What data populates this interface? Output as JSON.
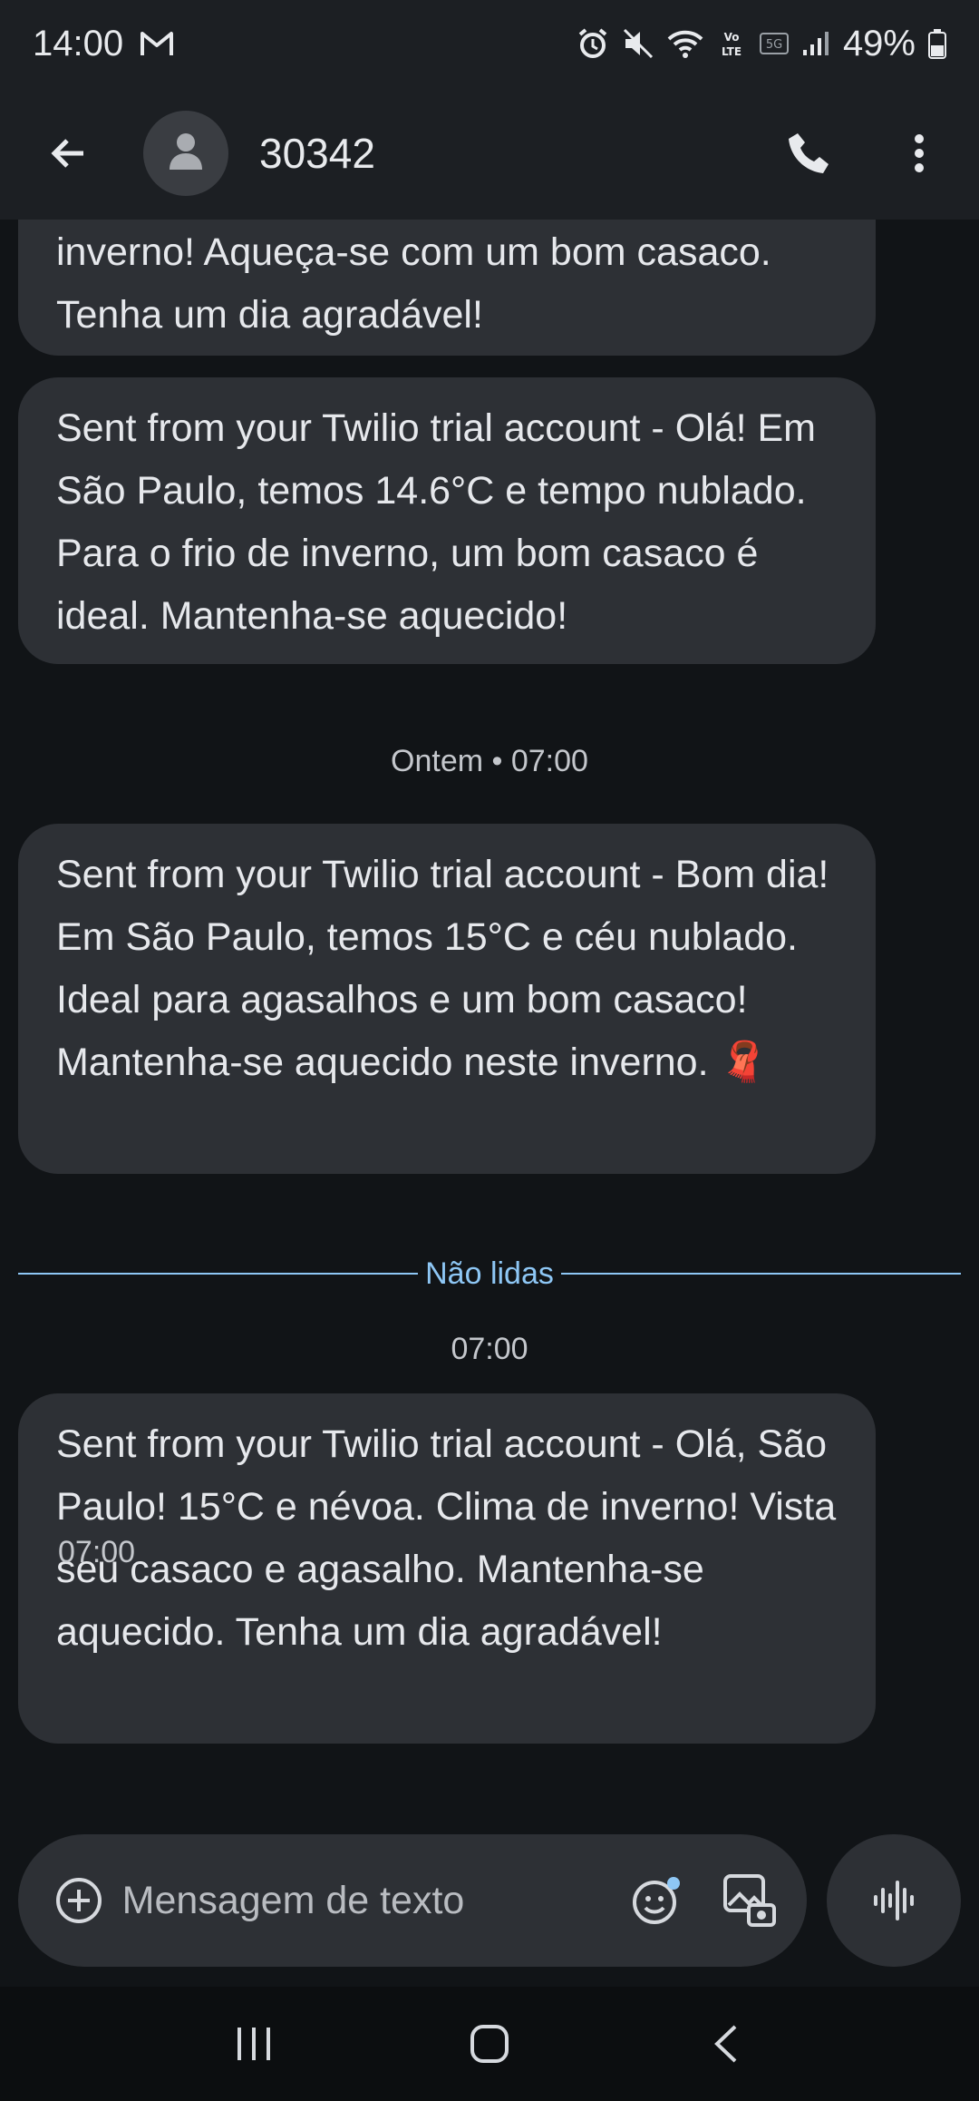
{
  "status_bar": {
    "time": "14:00",
    "battery": "49%",
    "icons": [
      "gmail-icon",
      "alarm-icon",
      "mute-icon",
      "wifi-icon",
      "volte-icon",
      "5g-icon",
      "signal-icon",
      "battery-icon"
    ]
  },
  "header": {
    "contact": "30342",
    "icons": [
      "back-arrow-icon",
      "person-avatar-icon",
      "phone-icon",
      "more-vert-icon"
    ]
  },
  "messages": [
    {
      "text": "inverno! Aqueça-se com um bom casaco. Tenha um dia agradável!"
    },
    {
      "text": "Sent from your Twilio trial account - Olá! Em São Paulo, temos 14.6°C e tempo nublado. Para o frio de inverno, um bom casaco é ideal. Mantenha-se aquecido!"
    },
    {
      "text": "Sent from your Twilio trial account - Bom dia! Em São Paulo, temos 15°C e céu nublado. Ideal para agasalhos e um bom casaco! Mantenha-se aquecido neste inverno. 🧣"
    },
    {
      "text": "Sent from your Twilio trial account - Olá, São Paulo! 15°C e névoa. Clima de inverno! Vista seu casaco e agasalho. Mantenha-se aquecido. Tenha um dia agradável!"
    }
  ],
  "separators": {
    "yesterday": "Ontem • 07:00",
    "unread": "Não lidas",
    "today_time": "07:00",
    "last_message_time": "07:00"
  },
  "composer": {
    "placeholder": "Mensagem de texto",
    "icons": [
      "add-icon",
      "emoji-icon",
      "gallery-icon",
      "voice-icon"
    ]
  },
  "nav": {
    "icons": [
      "recents-icon",
      "home-icon",
      "back-icon"
    ]
  },
  "colors": {
    "background": "#111417",
    "bar": "#1c1f23",
    "bubble": "#2d3035",
    "accent": "#8ec7f5"
  }
}
